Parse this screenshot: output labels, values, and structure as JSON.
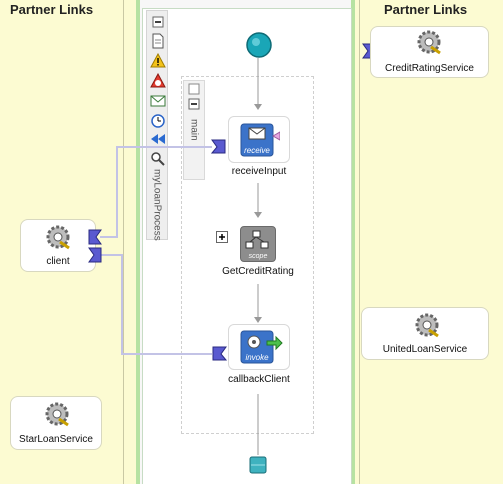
{
  "partner_links": {
    "left_header": "Partner Links",
    "right_header": "Partner Links",
    "left": [
      {
        "name": "client"
      },
      {
        "name": "StarLoanService"
      }
    ],
    "right": [
      {
        "name": "CreditRatingService"
      },
      {
        "name": "UnitedLoanService"
      }
    ]
  },
  "process": {
    "name": "myLoanProcess",
    "scope_name": "main",
    "activities": [
      {
        "name": "receiveInput",
        "type": "receive",
        "badge": "receive"
      },
      {
        "name": "GetCreditRating",
        "type": "scope",
        "badge": "scope"
      },
      {
        "name": "callbackClient",
        "type": "invoke",
        "badge": "invoke"
      }
    ]
  },
  "colors": {
    "lane_bg": "#fcfbd2",
    "process_border": "#b6e2a2",
    "link_line": "#c3c3e6",
    "start_node": "#1aa6b7",
    "end_node": "#3fb2bf"
  },
  "icons": {
    "toolbar": [
      "collapse-icon",
      "document-icon",
      "warning-icon",
      "error-icon",
      "email-icon",
      "timer-icon",
      "rewind-icon",
      "zoom-icon"
    ]
  }
}
